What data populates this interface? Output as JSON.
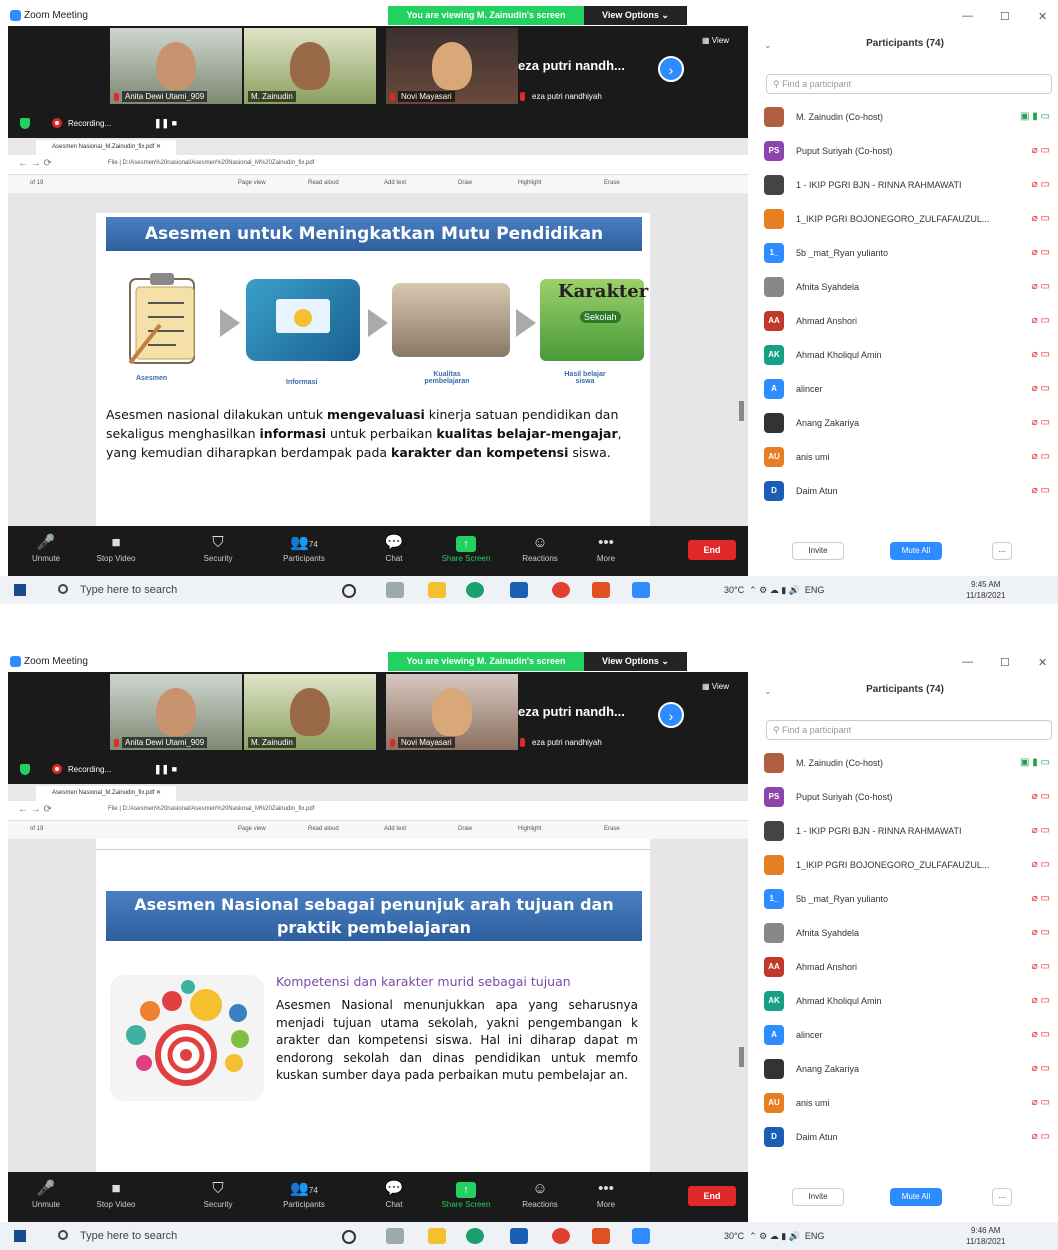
{
  "shots": [
    {
      "app_title": "Zoom Meeting",
      "banner": "You are viewing M. Zainudin's screen",
      "view_options": "View Options",
      "window_controls": [
        "—",
        "☐",
        "✕"
      ],
      "videos": [
        {
          "name": "Anita Dewi Utami_909"
        },
        {
          "name": "M. Zainudin"
        },
        {
          "name": "Novi Mayasari"
        }
      ],
      "eza_big": "eza putri nandh...",
      "eza_small": "eza putri nandhiyah",
      "view_label": "View",
      "recording": "Recording...",
      "recording_controls": "❚❚ ■",
      "browser": {
        "tab": "Asesmen Nasional_M.Zainudin_fix.pdf",
        "url": "File | D:/Asesmen%20nasional/Asesmen%20Nasional_M%20Zainudin_fix.pdf",
        "page_num": "of 19",
        "tools": [
          "Page view",
          "Read aloud",
          "Add text",
          "Draw",
          "Highlight",
          "Erase"
        ]
      },
      "slide": {
        "title": "Asesmen untuk Meningkatkan  Mutu Pendidikan",
        "flow": [
          "Asesmen",
          "Informasi",
          "Kualitas pembelajaran",
          "Hasil belajar siswa"
        ],
        "karakter_text": "Karakter",
        "sekolah_text": "Sekolah",
        "p1": "Asesmen nasional dilakukan untuk ",
        "p1b": "mengevaluasi",
        "p2": " kinerja satuan pendidikan dan sekaligus menghasilkan ",
        "p2b": "informasi",
        "p3": " untuk perbaikan ",
        "p3b": "kualitas  belajar-mengajar",
        "p4": ", yang kemudian diharapkan berdampak pada ",
        "p4b": "karakter dan kompetensi",
        "p5": " siswa."
      },
      "time": "9:45 AM",
      "date": "11/18/2021"
    },
    {
      "app_title": "Zoom Meeting",
      "banner": "You are viewing M. Zainudin's screen",
      "view_options": "View Options",
      "window_controls": [
        "—",
        "☐",
        "✕"
      ],
      "videos": [
        {
          "name": "Anita Dewi Utami_909"
        },
        {
          "name": "M. Zainudin"
        },
        {
          "name": "Novi Mayasari"
        }
      ],
      "eza_big": "eza putri nandh...",
      "eza_small": "eza putri nandhiyah",
      "view_label": "View",
      "recording": "Recording...",
      "recording_controls": "❚❚ ■",
      "browser": {
        "tab": "Asesmen Nasional_M.Zainudin_fix.pdf",
        "url": "File | D:/Asesmen%20nasional/Asesmen%20Nasional_M%20Zainudin_fix.pdf",
        "page_num": "of 19",
        "tools": [
          "Page view",
          "Read aloud",
          "Add text",
          "Draw",
          "Highlight",
          "Erase"
        ]
      },
      "slide": {
        "title_l1": "Asesmen Nasional sebagai penunjuk arah tujuan dan",
        "title_l2": "praktik  pembelajaran",
        "subtitle": "Kompetensi dan karakter murid sebagai tujuan",
        "body": "Asesmen Nasional menunjukkan apa yang seharusnya menjadi tujuan utama sekolah, yakni pengembangan k arakter dan kompetensi siswa. Hal ini diharap dapat m endorong sekolah dan dinas pendidikan untuk memfo kuskan sumber daya pada perbaikan mutu pembelajar an."
      },
      "time": "9:46 AM",
      "date": "11/18/2021"
    }
  ],
  "toolbar": [
    {
      "label": "Unmute",
      "icon": "mic-muted-icon",
      "glyph": "🎤"
    },
    {
      "label": "Stop Video",
      "icon": "video-icon",
      "glyph": "■"
    },
    {
      "label": "Security",
      "icon": "shield-icon",
      "glyph": "⛉"
    },
    {
      "label": "Participants",
      "icon": "participants-icon",
      "glyph": "👥",
      "count": "74"
    },
    {
      "label": "Chat",
      "icon": "chat-icon",
      "glyph": "💬"
    },
    {
      "label": "Share Screen",
      "icon": "share-screen-icon",
      "glyph": "↑"
    },
    {
      "label": "Reactions",
      "icon": "reactions-icon",
      "glyph": "☺"
    },
    {
      "label": "More",
      "icon": "more-icon",
      "glyph": "•••"
    }
  ],
  "end_label": "End",
  "participants": {
    "title": "Participants (74)",
    "search_placeholder": "Find a participant",
    "list": [
      {
        "name": "M. Zainudin (Co-host)",
        "initials": "",
        "color": "#b06040"
      },
      {
        "name": "Puput Suriyah (Co-host)",
        "initials": "PS",
        "color": "#8e44ad"
      },
      {
        "name": "1 - IKIP PGRI BJN - RINNA RAHMAWATI",
        "initials": "",
        "color": "#444444"
      },
      {
        "name": "1_IKIP PGRI BOJONEGORO_ZULFAFAUZUL...",
        "initials": "",
        "color": "#e67e22"
      },
      {
        "name": "5b _mat_Ryan yulianto",
        "initials": "1_",
        "color": "#2d8cff"
      },
      {
        "name": "Afnita Syahdela",
        "initials": "",
        "color": "#888888"
      },
      {
        "name": "Ahmad Anshori",
        "initials": "AA",
        "color": "#c0392b"
      },
      {
        "name": "Ahmad Kholiqul Amin",
        "initials": "AK",
        "color": "#16a085"
      },
      {
        "name": "alincer",
        "initials": "A",
        "color": "#2d8cff"
      },
      {
        "name": "Anang Zakariya",
        "initials": "",
        "color": "#333333"
      },
      {
        "name": "anis umi",
        "initials": "AU",
        "color": "#e67e22"
      },
      {
        "name": "Daim Atun",
        "initials": "D",
        "color": "#1a5fb4"
      }
    ],
    "invite": "Invite",
    "mute_all": "Mute All",
    "more": "..."
  },
  "taskbar": {
    "search_placeholder": "Type here to search",
    "temp": "30°C",
    "lang": "ENG"
  }
}
